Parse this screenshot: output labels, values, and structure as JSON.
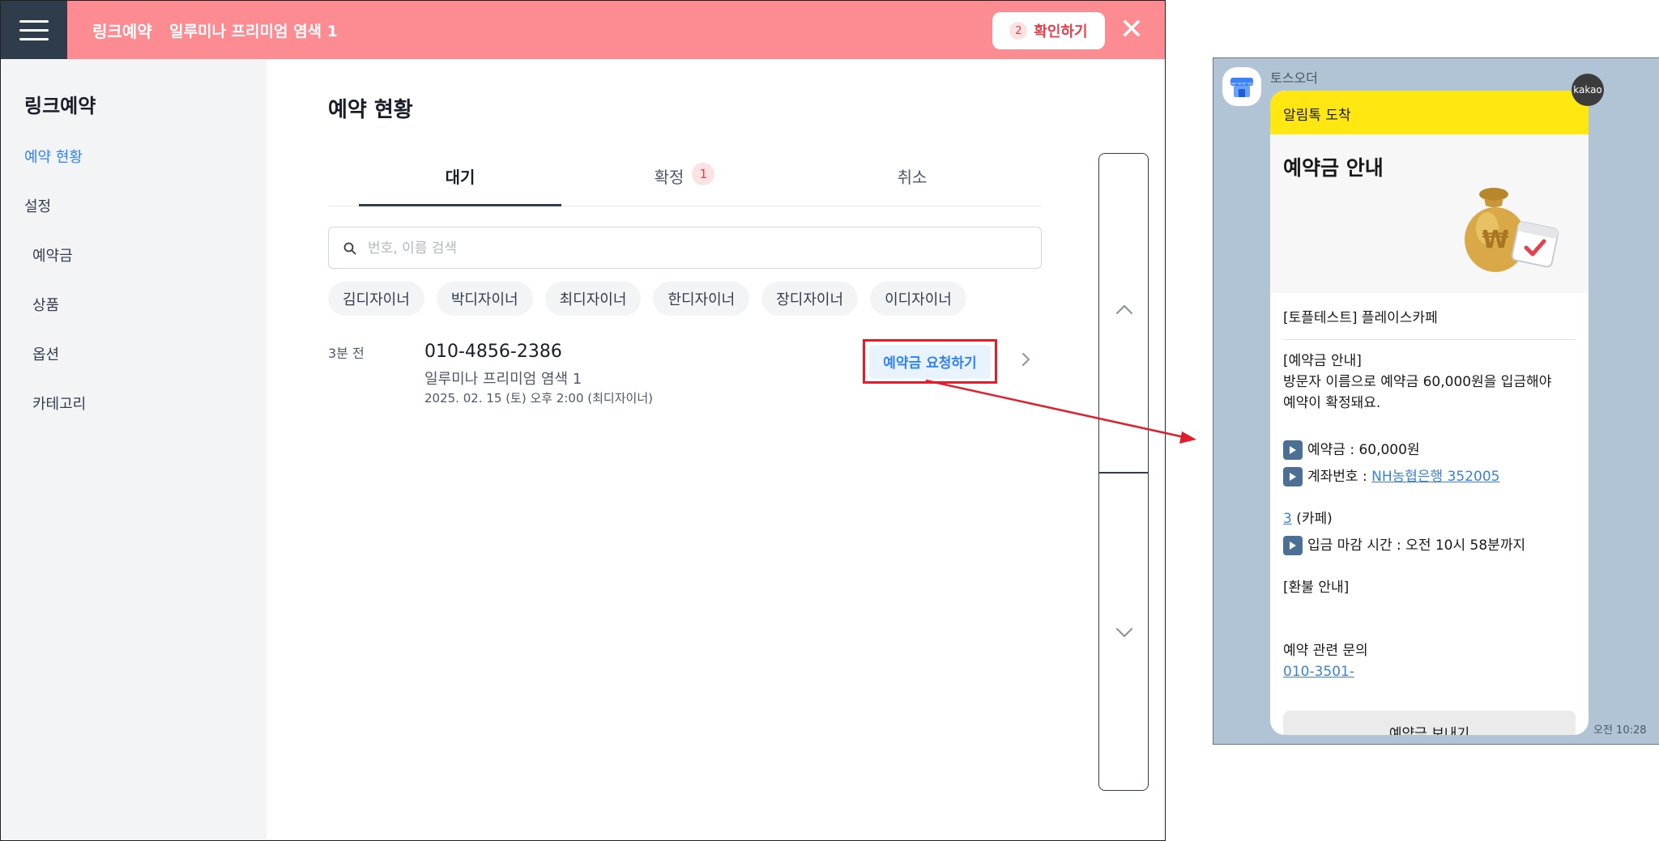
{
  "app": {
    "header": {
      "title": "링크예약",
      "subtitle": "일루미나 프리미엄 염색 1",
      "confirm_count": "2",
      "confirm_label": "확인하기",
      "close_symbol": "✕"
    },
    "sidebar": {
      "title": "링크예약",
      "items": [
        {
          "label": "예약 현황",
          "active": true
        },
        {
          "label": "설정",
          "active": false
        },
        {
          "label": "예약금",
          "active": false
        },
        {
          "label": "상품",
          "active": false
        },
        {
          "label": "옵션",
          "active": false
        },
        {
          "label": "카테고리",
          "active": false
        }
      ]
    },
    "main": {
      "title": "예약 현황",
      "tabs": [
        {
          "label": "대기",
          "active": true
        },
        {
          "label": "확정",
          "badge": "1"
        },
        {
          "label": "취소"
        }
      ],
      "search": {
        "placeholder": "번호, 이름 검색",
        "value": ""
      },
      "chips": [
        "김디자이너",
        "박디자이너",
        "최디자이너",
        "한디자이너",
        "장디자이너",
        "이디자이너"
      ],
      "reservation": {
        "time_ago": "3분 전",
        "phone": "010-4856-2386",
        "product": "일루미나 프리미엄 염색 1",
        "datetime": "2025. 02. 15 (토) 오후 2:00 (최디자이너)",
        "action_label": "예약금 요청하기"
      }
    }
  },
  "kakao": {
    "sender": "토스오더",
    "header_label": "알림톡 도착",
    "hero_title": "예약금 안내",
    "store": "[토플테스트] 플레이스카페",
    "notice_title": "[예약금 안내]",
    "notice_body": "방문자 이름으로 예약금 60,000원을 입금해야\n예약이 확정돼요.",
    "deposit_line": "예약금 : 60,000원",
    "account_prefix": "계좌번호 : ",
    "account_link_1": "NH농협은행 352005",
    "account_link_2": "3",
    "account_suffix": " (카페)",
    "deadline_line": "입금 마감 시간 : 오전 10시 58분까지",
    "refund_title": "[환불 안내]",
    "inquiry_label": "예약 관련 문의",
    "inquiry_link": "010-3501-",
    "action_label": "예약금 보내기",
    "brand": "kakao",
    "time": "오전 10:28"
  }
}
